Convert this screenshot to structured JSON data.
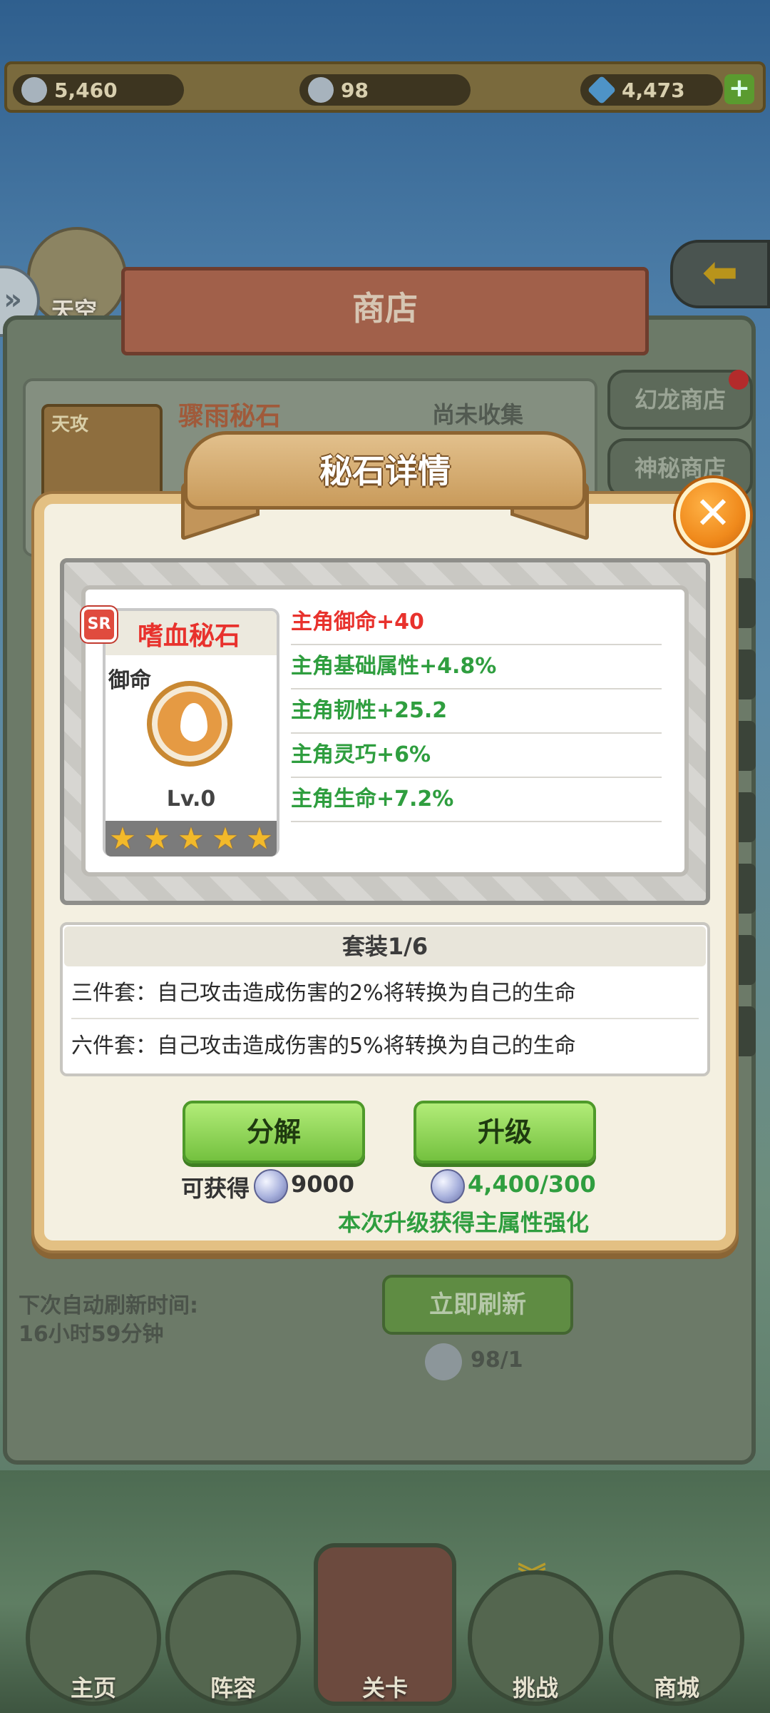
{
  "resources": {
    "wings": "5,460",
    "keys": "98",
    "diamonds": "4,473"
  },
  "background": {
    "sky_label": "天空",
    "shop_title": "商店",
    "card_tag": "天攻",
    "card_name": "骤雨秘石",
    "card_status": "尚未收集",
    "tabs": [
      "幻龙商店",
      "神秘商店"
    ],
    "refresh_label_1": "下次自动刷新时间:",
    "refresh_label_2": "16小时59分钟",
    "refresh_button": "立即刷新",
    "refresh_cost": "98/1"
  },
  "modal": {
    "title": "秘石详情",
    "stone": {
      "rarity": "SR",
      "name": "嗜血秘石",
      "type": "御命",
      "level": "Lv.0",
      "stars": 5,
      "icon": "water-drop-icon"
    },
    "attributes": [
      {
        "text": "主角御命+40",
        "color": "#e8322d"
      },
      {
        "text": "主角基础属性+4.8%",
        "color": "#2f9e3f"
      },
      {
        "text": "主角韧性+25.2",
        "color": "#2f9e3f"
      },
      {
        "text": "主角灵巧+6%",
        "color": "#2f9e3f"
      },
      {
        "text": "主角生命+7.2%",
        "color": "#2f9e3f"
      }
    ],
    "set": {
      "header": "套装1/6",
      "lines": [
        "三件套：自己攻击造成伤害的2%将转换为自己的生命",
        "六件套：自己攻击造成伤害的5%将转换为自己的生命"
      ]
    },
    "decompose": {
      "label": "分解",
      "gain_label": "可获得",
      "gain_value": "9000"
    },
    "upgrade": {
      "label": "升级",
      "cost": "4,400/300",
      "note": "本次升级获得主属性强化"
    }
  },
  "nav": [
    "主页",
    "阵容",
    "关卡",
    "挑战",
    "商城"
  ],
  "colors": {
    "accent_red": "#e8322d",
    "accent_green": "#2f9e3f",
    "button_green": "#74c13f",
    "frame_gold": "#e3c083"
  }
}
